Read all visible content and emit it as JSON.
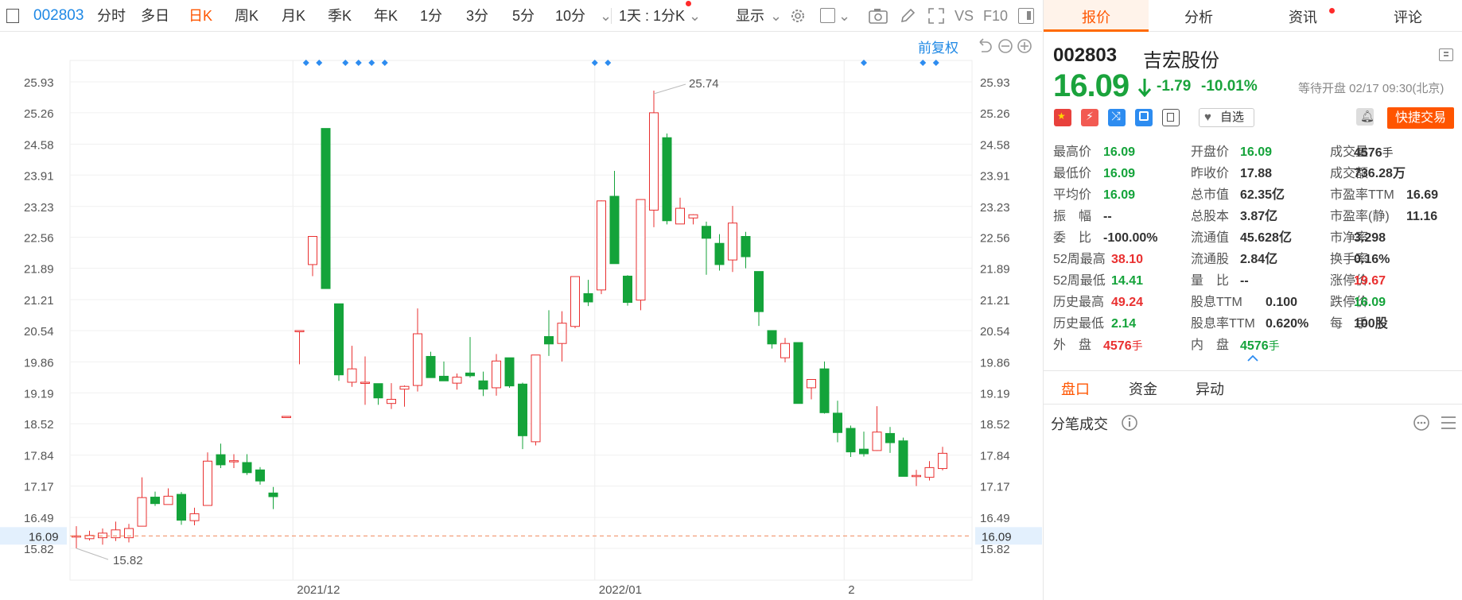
{
  "toolbar": {
    "code": "002803",
    "items": [
      "分时",
      "多日",
      "日K",
      "周K",
      "月K",
      "季K",
      "年K",
      "1分",
      "3分",
      "5分",
      "10分"
    ],
    "active": "日K",
    "range_select": "1天 : 1分K",
    "display_label": "显示",
    "vs_label": "VS",
    "f10_label": "F10",
    "adjust_label": "前复权"
  },
  "panel": {
    "tabs": [
      "报价",
      "分析",
      "资讯",
      "评论"
    ],
    "active_tab": "报价",
    "code": "002803",
    "name": "吉宏股份",
    "price": "16.09",
    "change": "-1.79",
    "change_pct": "-10.01%",
    "status": "等待开盘 02/17 09:30(北京)",
    "watch_label": "自选",
    "trade_label": "快捷交易",
    "stats": [
      [
        {
          "label": "最高价",
          "value": "16.09",
          "color": "down"
        },
        {
          "label": "开盘价",
          "value": "16.09",
          "color": "down"
        },
        {
          "label": "成交量",
          "value": "4576",
          "unit": "手",
          "color": "plain"
        }
      ],
      [
        {
          "label": "最低价",
          "value": "16.09",
          "color": "down"
        },
        {
          "label": "昨收价",
          "value": "17.88",
          "color": "plain"
        },
        {
          "label": "成交额",
          "value": "736.28万",
          "color": "plain"
        }
      ],
      [
        {
          "label": "平均价",
          "value": "16.09",
          "color": "down"
        },
        {
          "label": "总市值",
          "value": "62.35亿",
          "color": "plain"
        },
        {
          "label": "市盈率TTM",
          "value": "16.69",
          "color": "plain"
        }
      ],
      [
        {
          "label": "振　幅",
          "value": "--",
          "color": "plain"
        },
        {
          "label": "总股本",
          "value": "3.87亿",
          "color": "plain"
        },
        {
          "label": "市盈率(静)",
          "value": "11.16",
          "color": "plain"
        }
      ],
      [
        {
          "label": "委　比",
          "value": "-100.00%",
          "color": "plain"
        },
        {
          "label": "流通值",
          "value": "45.628亿",
          "color": "plain"
        },
        {
          "label": "市净率",
          "value": "3.298",
          "color": "plain"
        }
      ],
      [
        {
          "label": "52周最高",
          "value": "38.10",
          "color": "up"
        },
        {
          "label": "流通股",
          "value": "2.84亿",
          "color": "plain"
        },
        {
          "label": "换手率",
          "value": "0.16%",
          "color": "plain"
        }
      ],
      [
        {
          "label": "52周最低",
          "value": "14.41",
          "color": "down"
        },
        {
          "label": "量　比",
          "value": "--",
          "color": "plain"
        },
        {
          "label": "涨停价",
          "value": "19.67",
          "color": "up"
        }
      ],
      [
        {
          "label": "历史最高",
          "value": "49.24",
          "color": "up"
        },
        {
          "label": "股息TTM",
          "value": "0.100",
          "color": "plain"
        },
        {
          "label": "跌停价",
          "value": "16.09",
          "color": "down"
        }
      ],
      [
        {
          "label": "历史最低",
          "value": "2.14",
          "color": "down"
        },
        {
          "label": "股息率TTM",
          "value": "0.620%",
          "color": "plain"
        },
        {
          "label": "每　手",
          "value": "100股",
          "color": "plain"
        }
      ],
      [
        {
          "label": "外　盘",
          "value": "4576",
          "unit": "手",
          "color": "up"
        },
        {
          "label": "内　盘",
          "value": "4576",
          "unit": "手",
          "color": "down"
        },
        null
      ]
    ],
    "subtabs": [
      "盘口",
      "资金",
      "异动"
    ],
    "active_subtab": "盘口",
    "trades_title": "分笔成交"
  },
  "chart_data": {
    "type": "candlestick",
    "y_ticks": [
      "25.93",
      "25.26",
      "24.58",
      "23.91",
      "23.23",
      "22.56",
      "21.89",
      "21.21",
      "20.54",
      "19.86",
      "19.19",
      "18.52",
      "17.84",
      "17.17",
      "16.49",
      "15.82"
    ],
    "ylim": [
      15.82,
      25.93
    ],
    "x_labels": [
      {
        "label": "2021/12",
        "index": 17
      },
      {
        "label": "2022/01",
        "index": 40
      },
      {
        "label": "2",
        "index": 59
      }
    ],
    "last_price": "16.09",
    "max_label": "25.74",
    "min_label": "15.82",
    "candles": [
      {
        "o": 16.09,
        "h": 16.3,
        "l": 15.82,
        "c": 16.09
      },
      {
        "o": 16.03,
        "h": 16.2,
        "l": 15.99,
        "c": 16.1
      },
      {
        "o": 16.05,
        "h": 16.25,
        "l": 15.9,
        "c": 16.15
      },
      {
        "o": 16.05,
        "h": 16.4,
        "l": 15.98,
        "c": 16.22
      },
      {
        "o": 16.05,
        "h": 16.35,
        "l": 15.95,
        "c": 16.25
      },
      {
        "o": 16.3,
        "h": 17.36,
        "l": 16.3,
        "c": 16.92
      },
      {
        "o": 16.93,
        "h": 17.05,
        "l": 16.74,
        "c": 16.79
      },
      {
        "o": 16.77,
        "h": 17.12,
        "l": 16.77,
        "c": 16.95
      },
      {
        "o": 16.99,
        "h": 17.04,
        "l": 16.33,
        "c": 16.43
      },
      {
        "o": 16.42,
        "h": 16.7,
        "l": 16.32,
        "c": 16.57
      },
      {
        "o": 16.75,
        "h": 17.9,
        "l": 16.75,
        "c": 17.71
      },
      {
        "o": 17.85,
        "h": 18.09,
        "l": 17.56,
        "c": 17.63
      },
      {
        "o": 17.7,
        "h": 17.86,
        "l": 17.56,
        "c": 17.72
      },
      {
        "o": 17.68,
        "h": 17.86,
        "l": 17.41,
        "c": 17.46
      },
      {
        "o": 17.52,
        "h": 17.58,
        "l": 17.2,
        "c": 17.28
      },
      {
        "o": 17.02,
        "h": 17.15,
        "l": 16.67,
        "c": 16.94
      },
      {
        "o": 18.68,
        "h": 18.68,
        "l": 18.68,
        "c": 18.68
      },
      {
        "o": 20.54,
        "h": 20.54,
        "l": 19.81,
        "c": 20.54
      },
      {
        "o": 21.97,
        "h": 22.58,
        "l": 21.72,
        "c": 22.58
      },
      {
        "o": 24.92,
        "h": 24.92,
        "l": 21.45,
        "c": 21.45
      },
      {
        "o": 21.12,
        "h": 21.12,
        "l": 19.45,
        "c": 19.58
      },
      {
        "o": 19.42,
        "h": 20.21,
        "l": 19.32,
        "c": 19.71
      },
      {
        "o": 19.4,
        "h": 19.98,
        "l": 18.93,
        "c": 19.42
      },
      {
        "o": 19.39,
        "h": 19.39,
        "l": 18.93,
        "c": 19.08
      },
      {
        "o": 18.96,
        "h": 19.4,
        "l": 18.84,
        "c": 19.05
      },
      {
        "o": 19.27,
        "h": 19.35,
        "l": 18.89,
        "c": 19.33
      },
      {
        "o": 19.35,
        "h": 21.02,
        "l": 19.22,
        "c": 20.47
      },
      {
        "o": 19.98,
        "h": 20.08,
        "l": 19.56,
        "c": 19.52
      },
      {
        "o": 19.55,
        "h": 19.87,
        "l": 19.5,
        "c": 19.45
      },
      {
        "o": 19.4,
        "h": 19.61,
        "l": 19.26,
        "c": 19.53
      },
      {
        "o": 19.62,
        "h": 20.4,
        "l": 19.52,
        "c": 19.56
      },
      {
        "o": 19.45,
        "h": 19.65,
        "l": 19.12,
        "c": 19.27
      },
      {
        "o": 19.3,
        "h": 20.03,
        "l": 19.13,
        "c": 19.88
      },
      {
        "o": 19.95,
        "h": 19.95,
        "l": 19.3,
        "c": 19.34
      },
      {
        "o": 19.38,
        "h": 19.41,
        "l": 17.97,
        "c": 18.26
      },
      {
        "o": 18.13,
        "h": 20.01,
        "l": 18.05,
        "c": 20.01
      },
      {
        "o": 20.41,
        "h": 20.98,
        "l": 19.99,
        "c": 20.25
      },
      {
        "o": 20.26,
        "h": 20.96,
        "l": 19.87,
        "c": 20.7
      },
      {
        "o": 20.63,
        "h": 21.65,
        "l": 20.59,
        "c": 21.71
      },
      {
        "o": 21.34,
        "h": 21.64,
        "l": 21.07,
        "c": 21.16
      },
      {
        "o": 21.42,
        "h": 23.36,
        "l": 21.33,
        "c": 23.35
      },
      {
        "o": 23.45,
        "h": 24.0,
        "l": 22.0,
        "c": 21.99
      },
      {
        "o": 21.72,
        "h": 21.74,
        "l": 21.08,
        "c": 21.15
      },
      {
        "o": 21.2,
        "h": 23.38,
        "l": 20.98,
        "c": 23.38
      },
      {
        "o": 23.15,
        "h": 25.74,
        "l": 22.78,
        "c": 25.26
      },
      {
        "o": 24.72,
        "h": 24.81,
        "l": 22.84,
        "c": 22.92
      },
      {
        "o": 22.85,
        "h": 23.42,
        "l": 22.86,
        "c": 23.19
      },
      {
        "o": 22.98,
        "h": 23.06,
        "l": 22.84,
        "c": 23.05
      },
      {
        "o": 22.8,
        "h": 22.9,
        "l": 21.75,
        "c": 22.54
      },
      {
        "o": 22.43,
        "h": 22.63,
        "l": 21.84,
        "c": 21.97
      },
      {
        "o": 22.07,
        "h": 23.24,
        "l": 21.81,
        "c": 22.87
      },
      {
        "o": 22.58,
        "h": 22.68,
        "l": 21.89,
        "c": 22.14
      },
      {
        "o": 21.82,
        "h": 21.82,
        "l": 20.64,
        "c": 20.95
      },
      {
        "o": 20.54,
        "h": 20.54,
        "l": 20.15,
        "c": 20.25
      },
      {
        "o": 19.95,
        "h": 20.38,
        "l": 19.85,
        "c": 20.26
      },
      {
        "o": 20.28,
        "h": 20.28,
        "l": 18.96,
        "c": 18.96
      },
      {
        "o": 19.3,
        "h": 19.48,
        "l": 19.05,
        "c": 19.48
      },
      {
        "o": 19.71,
        "h": 19.87,
        "l": 18.74,
        "c": 18.76
      },
      {
        "o": 18.75,
        "h": 19.02,
        "l": 18.12,
        "c": 18.33
      },
      {
        "o": 18.42,
        "h": 18.48,
        "l": 17.8,
        "c": 17.91
      },
      {
        "o": 17.97,
        "h": 18.35,
        "l": 17.81,
        "c": 17.87
      },
      {
        "o": 17.94,
        "h": 18.9,
        "l": 17.93,
        "c": 18.34
      },
      {
        "o": 18.31,
        "h": 18.45,
        "l": 17.89,
        "c": 18.11
      },
      {
        "o": 18.15,
        "h": 18.22,
        "l": 17.38,
        "c": 17.38
      },
      {
        "o": 17.38,
        "h": 17.52,
        "l": 17.17,
        "c": 17.4
      },
      {
        "o": 17.36,
        "h": 17.71,
        "l": 17.29,
        "c": 17.57
      },
      {
        "o": 17.55,
        "h": 18.02,
        "l": 17.51,
        "c": 17.88
      }
    ],
    "markers": [
      17.5,
      18.5,
      20.5,
      21.5,
      22.5,
      23.5,
      39.5,
      40.5,
      60,
      64.5,
      65.5
    ]
  },
  "colors": {
    "up": "#e93030",
    "down": "#14a33a",
    "accent": "#ff5500",
    "blue": "#1e88e5"
  }
}
